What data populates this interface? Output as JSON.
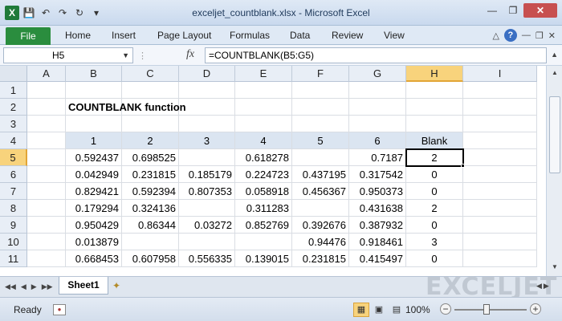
{
  "window": {
    "title": "exceljet_countblank.xlsx - Microsoft Excel",
    "app_icon_letter": "X"
  },
  "ribbon": {
    "file_label": "File",
    "tabs": [
      "Home",
      "Insert",
      "Page Layout",
      "Formulas",
      "Data",
      "Review",
      "View"
    ]
  },
  "formula_bar": {
    "name_box": "H5",
    "fx_label": "fx",
    "formula": "=COUNTBLANK(B5:G5)"
  },
  "sheet": {
    "columns": [
      "A",
      "B",
      "C",
      "D",
      "E",
      "F",
      "G",
      "H",
      "I"
    ],
    "selected_column": "H",
    "rows": [
      "1",
      "2",
      "3",
      "4",
      "5",
      "6",
      "7",
      "8",
      "9",
      "10",
      "11"
    ],
    "selected_row": "5",
    "title": "COUNTBLANK function",
    "table_headers": [
      "1",
      "2",
      "3",
      "4",
      "5",
      "6",
      "Blank"
    ],
    "table_rows": [
      [
        "0.592437",
        "0.698525",
        "",
        "0.618278",
        "",
        "0.7187",
        "2"
      ],
      [
        "0.042949",
        "0.231815",
        "0.185179",
        "0.224723",
        "0.437195",
        "0.317542",
        "0"
      ],
      [
        "0.829421",
        "0.592394",
        "0.807353",
        "0.058918",
        "0.456367",
        "0.950373",
        "0"
      ],
      [
        "0.179294",
        "0.324136",
        "",
        "0.311283",
        "",
        "0.431638",
        "2"
      ],
      [
        "0.950429",
        "0.86344",
        "0.03272",
        "0.852769",
        "0.392676",
        "0.387932",
        "0"
      ],
      [
        "0.013879",
        "",
        "",
        "",
        "0.94476",
        "0.918461",
        "3"
      ],
      [
        "0.668453",
        "0.607958",
        "0.556335",
        "0.139015",
        "0.231815",
        "0.415497",
        "0"
      ]
    ]
  },
  "sheet_tabs": {
    "active": "Sheet1"
  },
  "watermark": "EXCELJET",
  "status_bar": {
    "status": "Ready",
    "zoom": "100%"
  },
  "colors": {
    "file_tab": "#2a8d3e",
    "selected_header": "#f8d37c",
    "table_header_fill": "#dbe5f1"
  }
}
